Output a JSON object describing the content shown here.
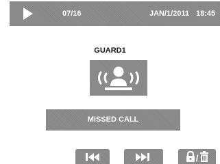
{
  "status_bar": {
    "play_icon": "play-icon",
    "counter": "07/16",
    "date": "JAN/1/2011",
    "time": "18:45"
  },
  "caller": {
    "name": "GUARD1",
    "icon": "guard-calling-icon"
  },
  "call_status": "MISSED CALL",
  "controls": {
    "prev_icon": "skip-previous-icon",
    "next_icon": "skip-next-icon",
    "lock_icon": "lock-icon",
    "separator": "/",
    "delete_icon": "trash-icon"
  },
  "colors": {
    "panel": "#8a8a8a",
    "foreground": "#ffffff",
    "background": "#ffffff"
  }
}
